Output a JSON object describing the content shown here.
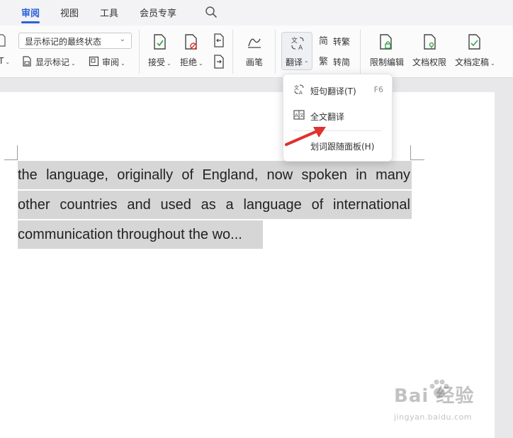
{
  "tabs": [
    {
      "label": "审阅",
      "active": true
    },
    {
      "label": "视图"
    },
    {
      "label": "工具"
    },
    {
      "label": "会员专享"
    }
  ],
  "ribbon": {
    "markup_state_select": "显示标记的最终状态",
    "show_markup": "显示标记",
    "review": "审阅",
    "accept": "接受",
    "reject": "拒绝",
    "pen": "画笔",
    "translate": "翻译",
    "to_traditional": "转繁",
    "to_simplified": "转简",
    "restrict_edit": "限制编辑",
    "doc_permission": "文档权限",
    "doc_finalize": "文档定稿",
    "partial_left_label": "T"
  },
  "translate_menu": {
    "items": [
      {
        "label": "短句翻译(T)",
        "shortcut": "F6"
      },
      {
        "label": "全文翻译"
      },
      {
        "label": "划词跟随面板(H)"
      }
    ]
  },
  "document": {
    "lines": [
      "the language, originally of England, now spoken in many",
      "other countries and used as a language of international",
      "communication throughout the wo..."
    ]
  },
  "watermark": {
    "brand": "Bai  经验",
    "url": "jingyan.baidu.com"
  },
  "colors": {
    "accent": "#2a62d8",
    "selection": "#d6d6d6",
    "arrow": "#e0322e"
  }
}
